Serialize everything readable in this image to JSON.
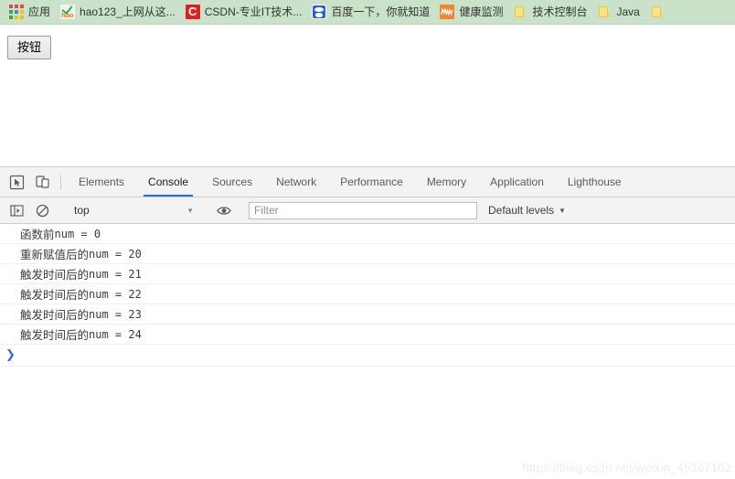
{
  "bookmarks_bar": {
    "items": [
      {
        "label": "应用",
        "icon": "apps-grid-icon"
      },
      {
        "label": "hao123_上网从这...",
        "icon": "hao123-icon"
      },
      {
        "label": "CSDN-专业IT技术...",
        "icon": "csdn-icon"
      },
      {
        "label": "百度一下，你就知道",
        "icon": "baidu-icon"
      },
      {
        "label": "健康监测",
        "icon": "health-monitor-icon"
      },
      {
        "label": "技术控制台",
        "icon": "folder-icon"
      },
      {
        "label": "Java",
        "icon": "folder-icon"
      },
      {
        "label": "",
        "icon": "folder-icon"
      }
    ],
    "colors": {
      "background": "#c9e2c9",
      "apps_grid": [
        "#e8453c",
        "#e8453c",
        "#e8453c",
        "#34a853",
        "#4285f4",
        "#fbbc05",
        "#34a853",
        "#fbbc05",
        "#fbbc05"
      ],
      "csdn_red": "#e02020",
      "health_orange": "#f5842a",
      "folder_yellow": "#fbe183"
    }
  },
  "page": {
    "button_label": "按钮"
  },
  "devtools": {
    "toolbar_icons": [
      {
        "name": "inspect-element-icon"
      },
      {
        "name": "device-toolbar-icon"
      }
    ],
    "tabs": [
      {
        "label": "Elements",
        "active": false
      },
      {
        "label": "Console",
        "active": true
      },
      {
        "label": "Sources",
        "active": false
      },
      {
        "label": "Network",
        "active": false
      },
      {
        "label": "Performance",
        "active": false
      },
      {
        "label": "Memory",
        "active": false
      },
      {
        "label": "Application",
        "active": false
      },
      {
        "label": "Lighthouse",
        "active": false
      }
    ],
    "active_tab_color": "#1a73e8",
    "console_toolbar": {
      "sidebar_toggle_icon": "console-sidebar-icon",
      "clear_icon": "clear-console-icon",
      "context": "top",
      "eye_icon": "live-expression-eye-icon",
      "filter_value": "",
      "filter_placeholder": "Filter",
      "levels_label": "Default levels"
    },
    "console_messages": [
      {
        "cn": "函数前",
        "code": "num = 0"
      },
      {
        "cn": "重新赋值后的",
        "code": "num = 20"
      },
      {
        "cn": "触发时间后的",
        "code": "num = 21"
      },
      {
        "cn": "触发时间后的",
        "code": "num = 22"
      },
      {
        "cn": "触发时间后的",
        "code": "num = 23"
      },
      {
        "cn": "触发时间后的",
        "code": "num = 24"
      }
    ],
    "prompt_symbol": "❯"
  },
  "watermark": "https://blog.csdn.net/weixin_45267102"
}
